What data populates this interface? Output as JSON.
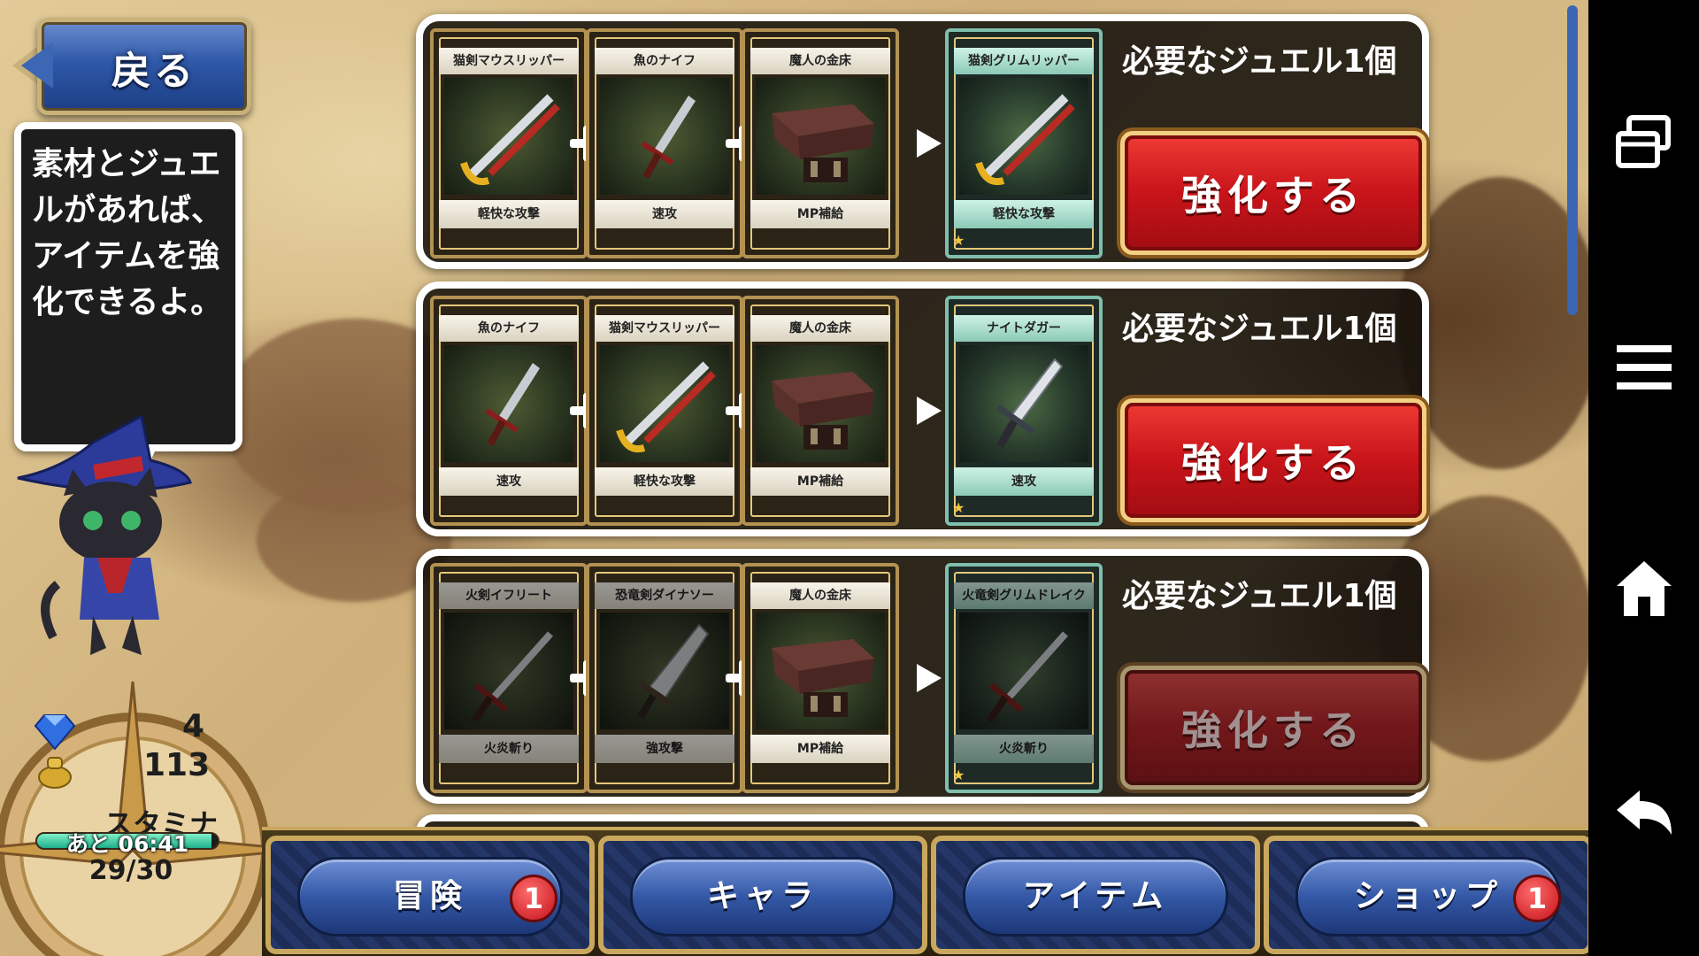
{
  "back_button": {
    "label": "戻る"
  },
  "speech_bubble": {
    "text": "素材とジュエ\nルがあれば、\nアイテムを強\n化できるよ。"
  },
  "stats": {
    "gems": "4",
    "gold": "113",
    "stamina_label": "スタミナ",
    "stamina_timer": "あと 06:41",
    "stamina_value": "29/30",
    "stamina_fraction": 0.967
  },
  "recipes": [
    {
      "materials": [
        {
          "name": "猫剣マウスリッパー",
          "skill": "軽快な攻撃",
          "art": "sword-icon"
        },
        {
          "name": "魚のナイフ",
          "skill": "速攻",
          "art": "knife-icon"
        },
        {
          "name": "魔人の金床",
          "skill": "MP補給",
          "art": "anvil-icon"
        }
      ],
      "result": {
        "name": "猫剣グリムリッパー",
        "skill": "軽快な攻撃",
        "art": "sword-icon"
      },
      "required": "必要なジュエル1個",
      "button_label": "強化する",
      "enabled": true
    },
    {
      "materials": [
        {
          "name": "魚のナイフ",
          "skill": "速攻",
          "art": "knife-icon"
        },
        {
          "name": "猫剣マウスリッパー",
          "skill": "軽快な攻撃",
          "art": "sword-icon"
        },
        {
          "name": "魔人の金床",
          "skill": "MP補給",
          "art": "anvil-icon"
        }
      ],
      "result": {
        "name": "ナイトダガー",
        "skill": "速攻",
        "art": "dagger-icon"
      },
      "required": "必要なジュエル1個",
      "button_label": "強化する",
      "enabled": true
    },
    {
      "materials": [
        {
          "name": "火剣イフリート",
          "skill": "火炎斬り",
          "art": "flame-sword-icon",
          "dim": true
        },
        {
          "name": "恐竜剣ダイナソー",
          "skill": "強攻撃",
          "art": "broadsword-icon",
          "dim": true
        },
        {
          "name": "魔人の金床",
          "skill": "MP補給",
          "art": "anvil-icon"
        }
      ],
      "result": {
        "name": "火竜剣グリムドレイク",
        "skill": "火炎斬り",
        "art": "flame-sword-icon",
        "dim": true
      },
      "required": "必要なジュエル1個",
      "button_label": "強化する",
      "enabled": false
    }
  ],
  "nav": [
    {
      "label": "冒険",
      "badge": "1"
    },
    {
      "label": "キャラ",
      "badge": null
    },
    {
      "label": "アイテム",
      "badge": null
    },
    {
      "label": "ショップ",
      "badge": "1"
    }
  ],
  "system_bar": [
    "recent-apps-icon",
    "menu-icon",
    "home-icon",
    "back-arrow-icon"
  ],
  "colors": {
    "enhance_red": "#c8141a",
    "nav_blue": "#3458a6",
    "panel_bg": "#1a1510"
  }
}
